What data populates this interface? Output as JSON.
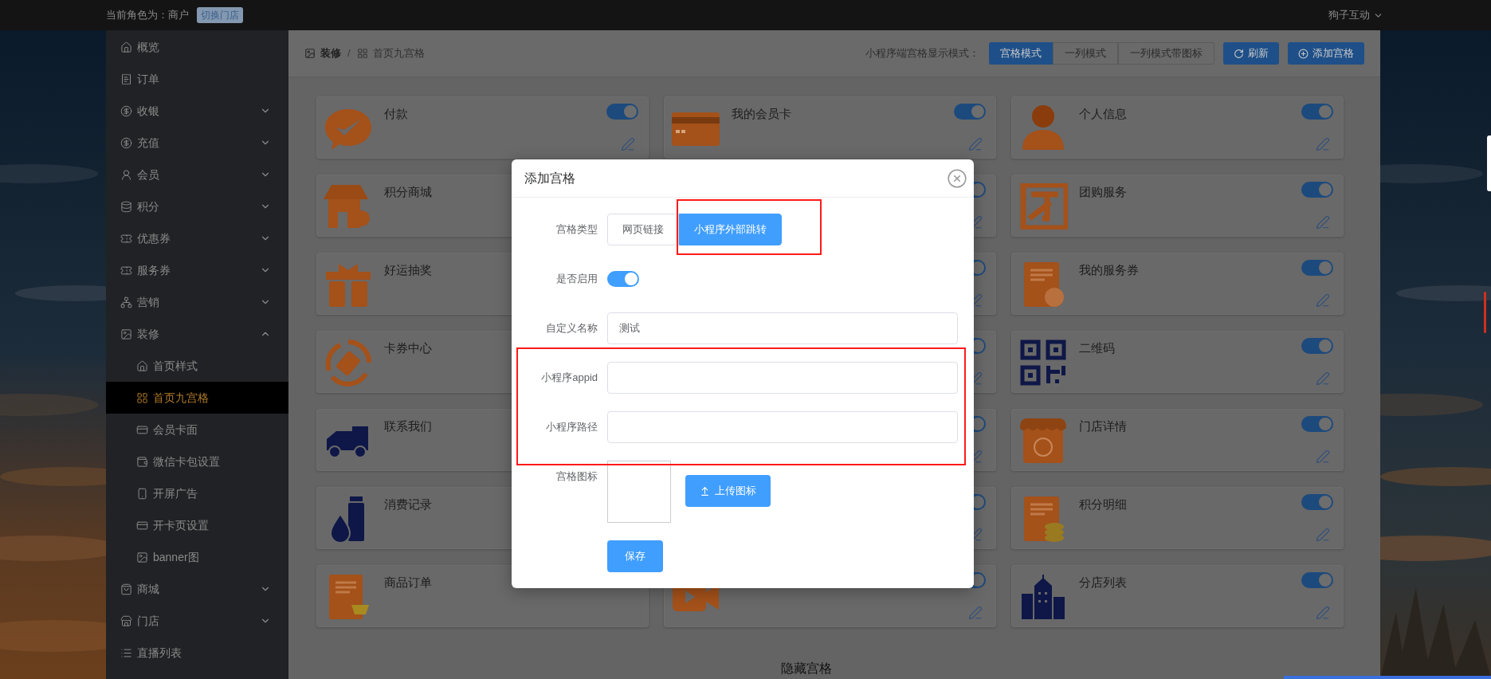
{
  "top_bar": {
    "role_text": "当前角色为：商户",
    "switch_store_button": "切换门店",
    "user_menu": "狗子互动"
  },
  "sidebar": {
    "items": [
      {
        "label": "概览",
        "selected": false
      },
      {
        "label": "订单",
        "selected": false
      },
      {
        "label": "收银",
        "selected": false,
        "expanded": false
      },
      {
        "label": "充值",
        "selected": false,
        "expanded": false
      },
      {
        "label": "会员",
        "selected": false,
        "expanded": false
      },
      {
        "label": "积分",
        "selected": false,
        "expanded": false
      },
      {
        "label": "优惠券",
        "selected": false,
        "expanded": false
      },
      {
        "label": "服务券",
        "selected": false,
        "expanded": false
      },
      {
        "label": "营销",
        "selected": false,
        "expanded": false
      },
      {
        "label": "装修",
        "selected": false,
        "expanded": true,
        "children": [
          {
            "label": "首页样式",
            "selected": false
          },
          {
            "label": "首页九宫格",
            "selected": true
          },
          {
            "label": "会员卡面",
            "selected": false
          },
          {
            "label": "微信卡包设置",
            "selected": false
          },
          {
            "label": "开屏广告",
            "selected": false
          },
          {
            "label": "开卡页设置",
            "selected": false
          },
          {
            "label": "banner图",
            "selected": false
          }
        ]
      },
      {
        "label": "商城",
        "selected": false,
        "expanded": false
      },
      {
        "label": "门店",
        "selected": false,
        "expanded": false
      },
      {
        "label": "直播列表",
        "selected": false
      }
    ]
  },
  "breadcrumb": [
    "装修",
    "首页九宫格"
  ],
  "breadcrumb_separator": "/",
  "display_mode": {
    "label": "小程序端宫格显示模式：",
    "options": [
      {
        "label": "宫格模式",
        "selected": true
      },
      {
        "label": "一列模式",
        "selected": false
      },
      {
        "label": "一列模式带图标",
        "selected": false
      }
    ]
  },
  "toolbar_buttons": [
    "刷新",
    "添加宫格"
  ],
  "grid": {
    "cards": [
      {
        "title": "付款",
        "enabled": true
      },
      {
        "title": "我的会员卡",
        "enabled": true
      },
      {
        "title": "个人信息",
        "enabled": true
      },
      {
        "title": "积分商城"
      },
      {
        "enabled": true
      },
      {
        "title": "团购服务",
        "enabled": true
      },
      {
        "title": "好运抽奖"
      },
      {
        "enabled": true
      },
      {
        "title": "我的服务券",
        "enabled": true
      },
      {
        "title": "卡券中心"
      },
      {
        "enabled": true
      },
      {
        "title": "二维码",
        "enabled": true
      },
      {
        "title": "联系我们"
      },
      {
        "enabled": true
      },
      {
        "title": "门店详情",
        "enabled": true
      },
      {
        "title": "消费记录"
      },
      {
        "enabled": true
      },
      {
        "title": "积分明细",
        "enabled": true
      },
      {
        "title": "商品订单"
      },
      {
        "enabled": true
      },
      {
        "title": "分店列表",
        "enabled": true
      }
    ]
  },
  "hidden_section_title": "隐藏宫格",
  "dialog": {
    "title": "添加宫格",
    "fields": [
      {
        "kind": "segmented",
        "label": "宫格类型",
        "options": [
          {
            "label": "网页链接",
            "selected": false,
            "highlighted": false
          },
          {
            "label": "小程序外部跳转",
            "selected": true,
            "highlighted": true
          }
        ]
      },
      {
        "kind": "switch",
        "label": "是否启用",
        "on": true
      },
      {
        "kind": "text",
        "label": "自定义名称",
        "value": "测试"
      },
      {
        "kind": "text",
        "label": "小程序appid",
        "highlighted": true
      },
      {
        "kind": "text",
        "label": "小程序路径",
        "highlighted": true
      },
      {
        "kind": "upload",
        "label": "宫格图标",
        "button": "上传图标"
      }
    ],
    "save_button": "保存"
  }
}
